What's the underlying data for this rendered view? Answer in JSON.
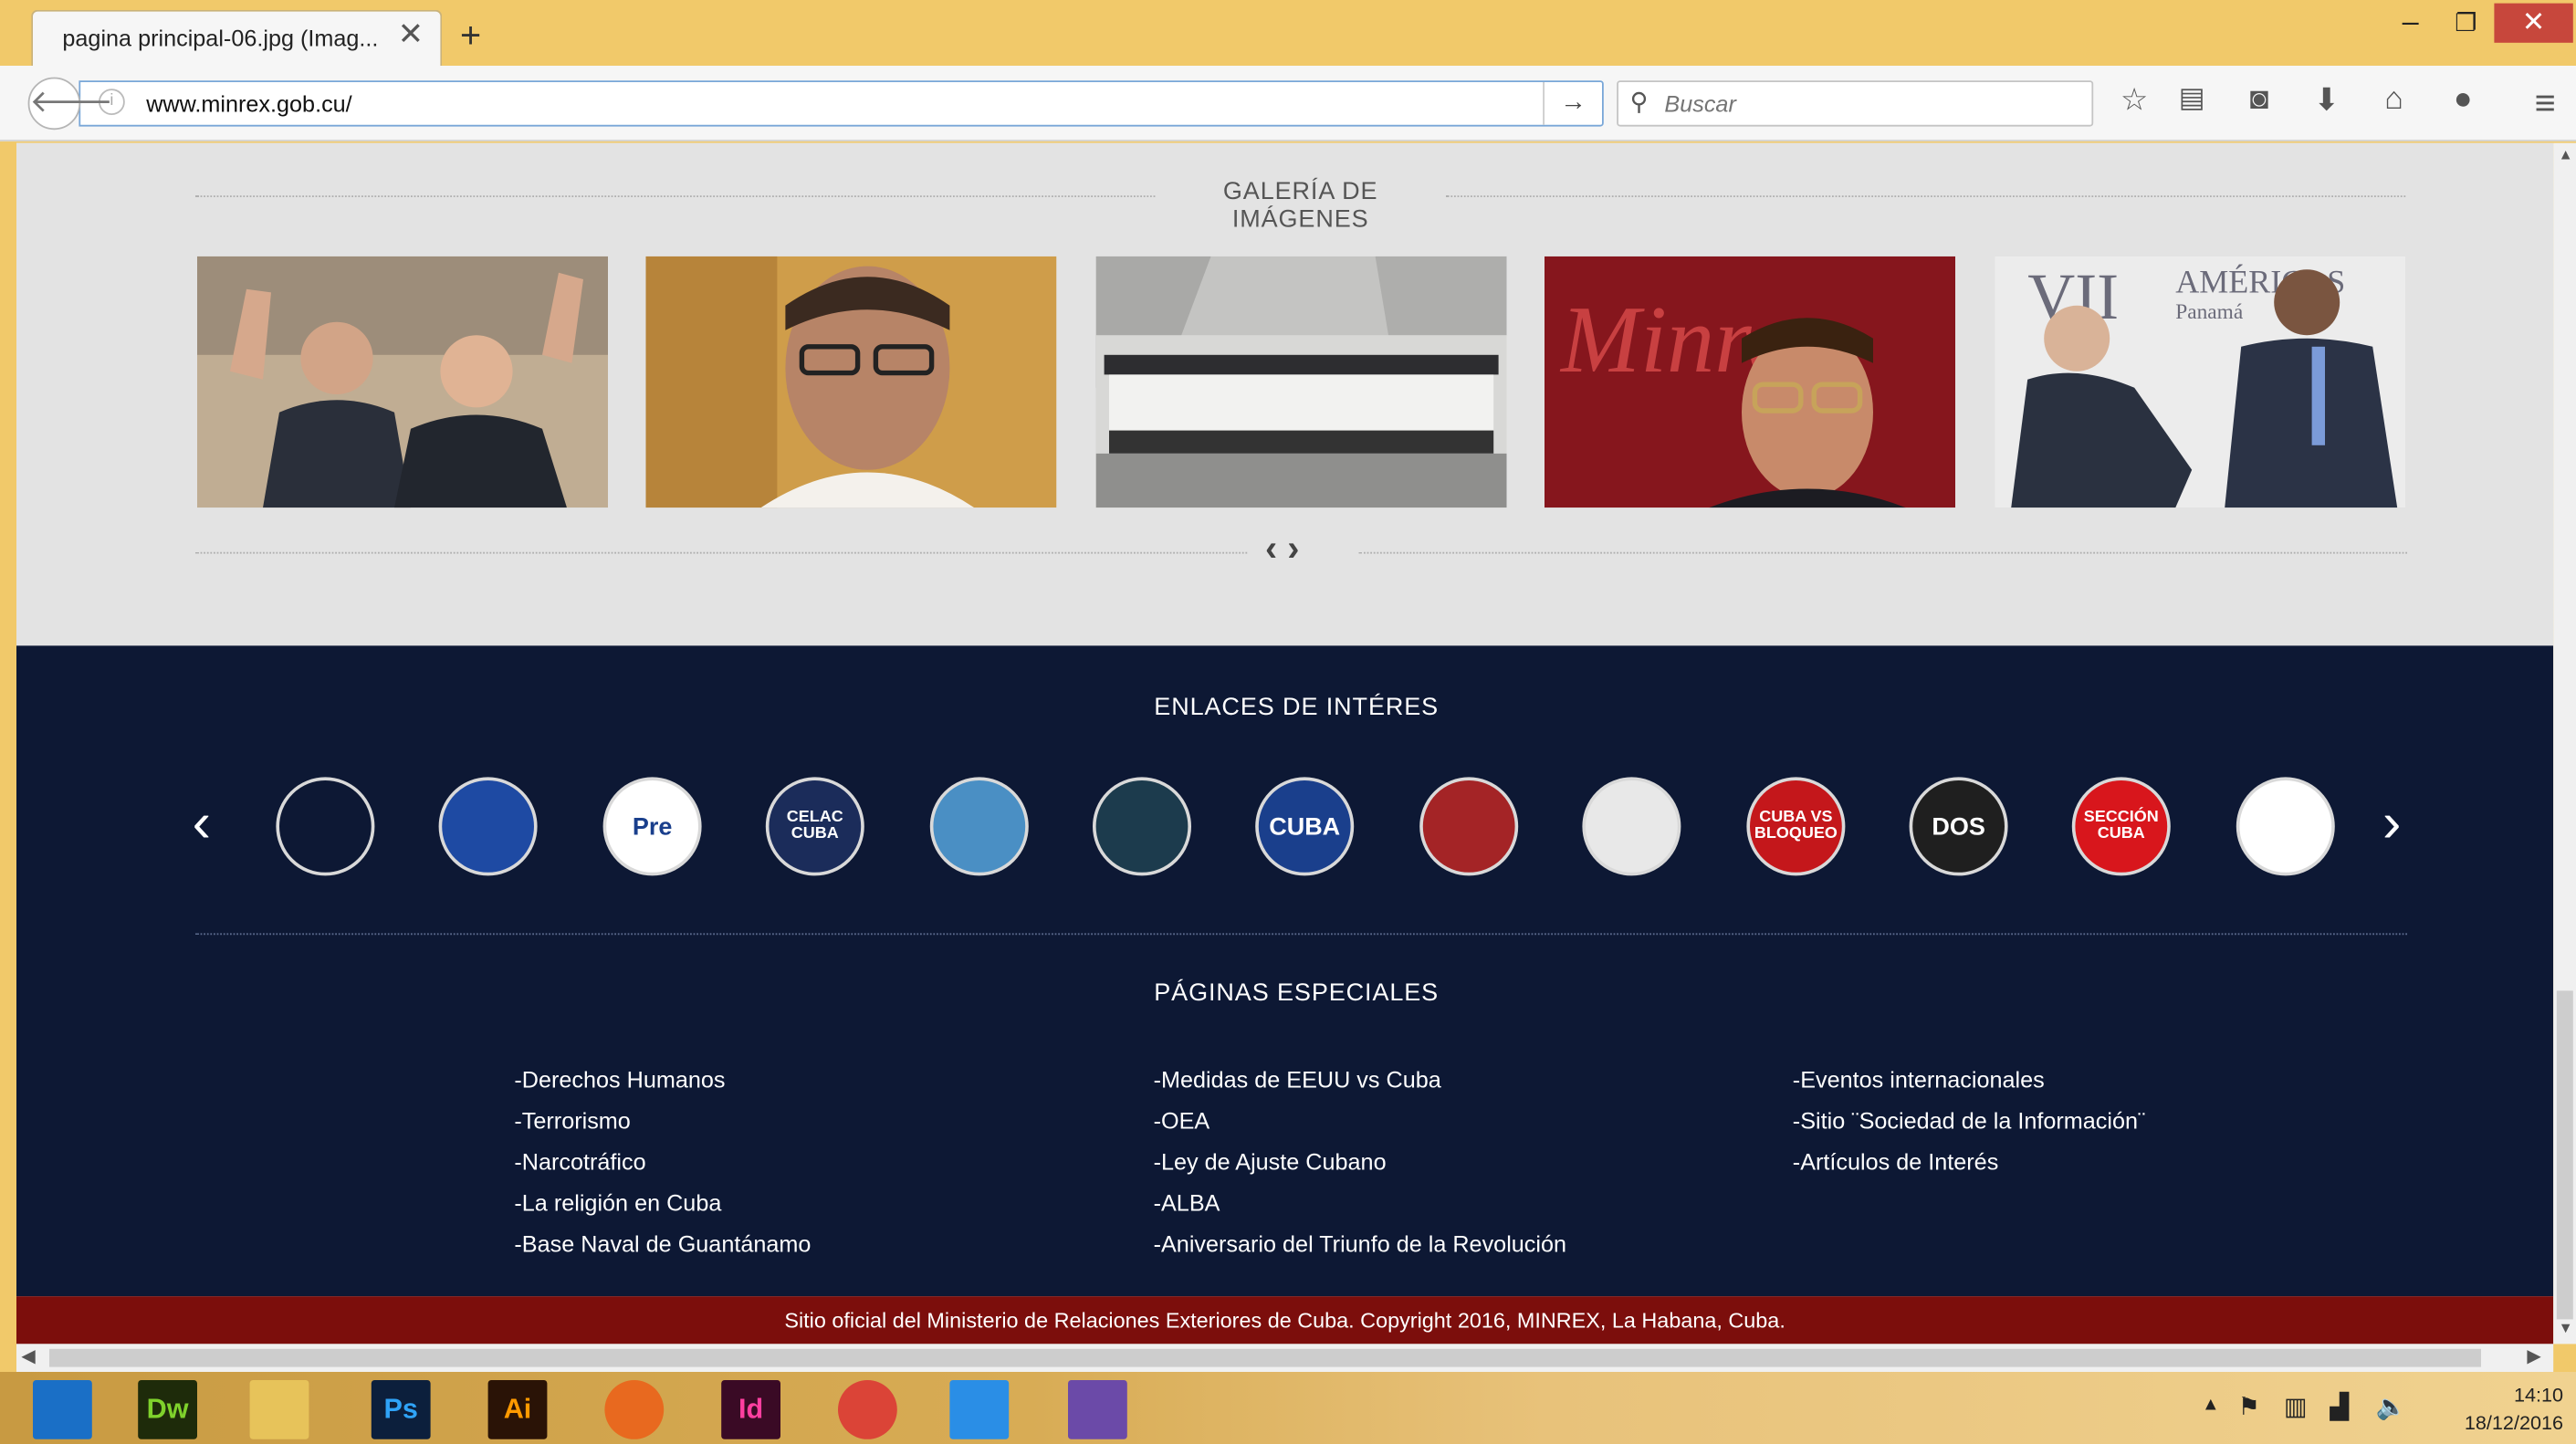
{
  "browser": {
    "tab_title": "pagina principal-06.jpg (Imag...",
    "tab_close": "✕",
    "new_tab": "+",
    "url": "www.minrex.gob.cu/",
    "search_placeholder": "Buscar",
    "window_controls": {
      "minimize": "–",
      "restore": "❐",
      "close": "✕"
    }
  },
  "gallery": {
    "title": "GALERÍA DE IMÁGENES",
    "arrows": "‹ ›",
    "images": [
      {
        "icon": "leaders-waving-photo",
        "bg": "#b9a58e"
      },
      {
        "icon": "official-portrait-photo",
        "bg": "#c89646"
      },
      {
        "icon": "group-photo",
        "bg": "#b7b7b4",
        "text": ""
      },
      {
        "icon": "minrex-minister-photo",
        "bg": "#8b1f24",
        "text": "Minrex"
      },
      {
        "icon": "handshake-photo",
        "bg": "#e6e6e6",
        "text": "VII AMÉRICAS Panamá"
      }
    ]
  },
  "links": {
    "title": "ENLACES DE INTÉRES",
    "prev": "‹",
    "next": "›",
    "items": [
      {
        "icon": "cubaminrex-logo-icon",
        "text": "",
        "bg": "#0d1834"
      },
      {
        "icon": "prensa-latina-logo-icon",
        "text": "",
        "bg": "#1e4aa3"
      },
      {
        "icon": "prensa-logo-icon",
        "text": "Pre",
        "bg": "#ffffff"
      },
      {
        "icon": "celac-logo-icon",
        "text": "CELAC CUBA",
        "bg": "#1b2c5a"
      },
      {
        "icon": "un-logo-icon",
        "text": "",
        "bg": "#4a8fc4"
      },
      {
        "icon": "documents-logo-icon",
        "text": "",
        "bg": "#1c3b4d"
      },
      {
        "icon": "cuba-diplomatica-logo-icon",
        "text": "CUBA",
        "bg": "#1a3f8c"
      },
      {
        "icon": "piratas-logo-icon",
        "text": "",
        "bg": "#a42426"
      },
      {
        "icon": "cuba-globe-logo-icon",
        "text": "",
        "bg": "#e8e8e8"
      },
      {
        "icon": "cuba-vs-bloqueo-logo-icon",
        "text": "CUBA VS BLOQUEO",
        "bg": "#c4171b"
      },
      {
        "icon": "dos-asesinos-logo-icon",
        "text": "DOS",
        "bg": "#1f1f1f"
      },
      {
        "icon": "seccion-cuba-logo-icon",
        "text": "SECCIÓN CUBA",
        "bg": "#d8161c"
      },
      {
        "icon": "globe-logo-icon",
        "text": "",
        "bg": "#ffffff"
      }
    ]
  },
  "special": {
    "title": "PÁGINAS ESPECIALES",
    "columns": [
      [
        "-Derechos Humanos",
        "-Terrorismo",
        "-Narcotráfico",
        "-La religión en Cuba",
        "-Base Naval de Guantánamo"
      ],
      [
        "-Medidas de EEUU vs Cuba",
        "-OEA",
        "-Ley de Ajuste Cubano",
        "-ALBA",
        "-Aniversario del Triunfo de la Revolución"
      ],
      [
        "-Eventos internacionales",
        "-Sitio ¨Sociedad de la Información¨",
        "-Artículos de Interés"
      ]
    ]
  },
  "footer": {
    "text": "Sitio oficial del Ministerio de Relaciones Exteriores de Cuba. Copyright 2016, MINREX, La Habana, Cuba."
  },
  "taskbar": {
    "apps": [
      {
        "icon": "windows-start-icon",
        "text": "",
        "bg": "#1a6fc6",
        "fg": "#ffffff"
      },
      {
        "icon": "dreamweaver-icon",
        "text": "Dw",
        "bg": "#1e2b0a",
        "fg": "#7fd12c"
      },
      {
        "icon": "file-explorer-icon",
        "text": "",
        "bg": "#e7c35a",
        "fg": "#ffffff"
      },
      {
        "icon": "photoshop-icon",
        "text": "Ps",
        "bg": "#0c1f3c",
        "fg": "#2fa3f7"
      },
      {
        "icon": "illustrator-icon",
        "text": "Ai",
        "bg": "#2a1306",
        "fg": "#ff9a00"
      },
      {
        "icon": "firefox-icon",
        "text": "",
        "bg": "#e8691f",
        "fg": "#ffffff"
      },
      {
        "icon": "indesign-icon",
        "text": "Id",
        "bg": "#3a0a25",
        "fg": "#ff3fa0"
      },
      {
        "icon": "chrome-icon",
        "text": "",
        "bg": "#db4437",
        "fg": "#ffffff"
      },
      {
        "icon": "media-player-icon",
        "text": "",
        "bg": "#2a8ee6",
        "fg": "#ffffff"
      },
      {
        "icon": "visual-studio-icon",
        "text": "",
        "bg": "#6b4aa8",
        "fg": "#ffffff"
      }
    ],
    "time": "14:10",
    "date": "18/12/2016"
  }
}
